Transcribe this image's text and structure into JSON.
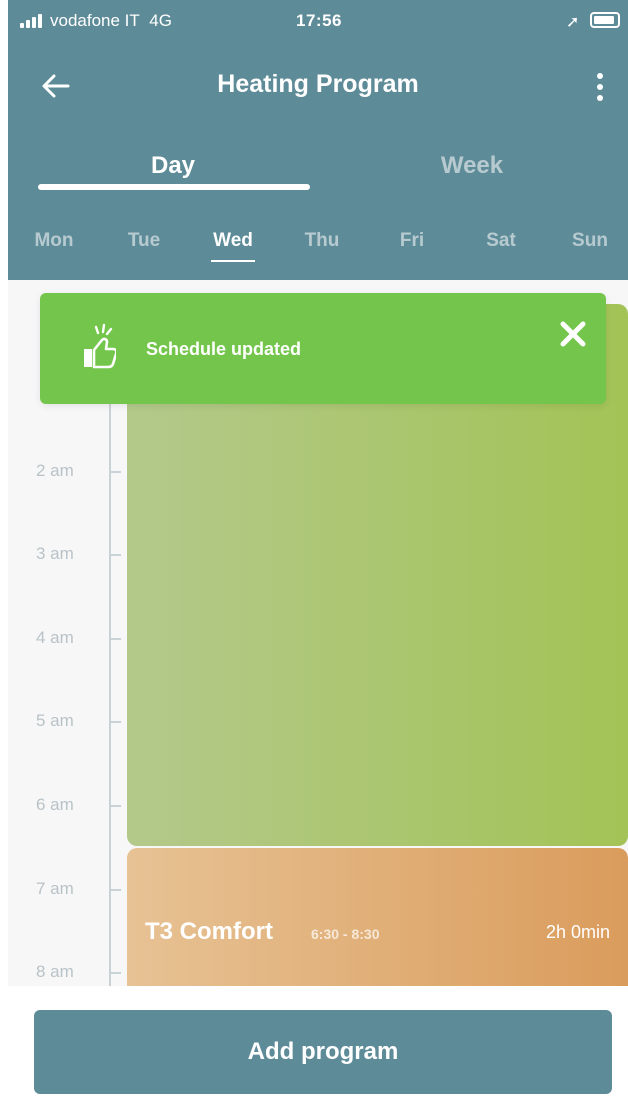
{
  "status_bar": {
    "carrier": "vodafone IT",
    "network": "4G",
    "time": "17:56"
  },
  "header": {
    "title": "Heating Program"
  },
  "tabs": [
    {
      "label": "Day",
      "active": true
    },
    {
      "label": "Week",
      "active": false
    }
  ],
  "days": [
    {
      "label": "Mon",
      "active": false
    },
    {
      "label": "Tue",
      "active": false
    },
    {
      "label": "Wed",
      "active": true
    },
    {
      "label": "Thu",
      "active": false
    },
    {
      "label": "Fri",
      "active": false
    },
    {
      "label": "Sat",
      "active": false
    },
    {
      "label": "Sun",
      "active": false
    }
  ],
  "timeline": {
    "hours": [
      "2 am",
      "3 am",
      "4 am",
      "5 am",
      "6 am",
      "7 am",
      "8 am"
    ]
  },
  "programs": [
    {
      "name": "T3 Comfort",
      "time_range": "6:30 - 8:30",
      "duration": "2h 0min"
    }
  ],
  "toast": {
    "message": "Schedule updated"
  },
  "footer": {
    "add_program_label": "Add program"
  },
  "colors": {
    "primary": "#5e8b98",
    "toast": "#73c64b",
    "green_program": "#a3c356",
    "orange_program": "#da9c5c"
  }
}
